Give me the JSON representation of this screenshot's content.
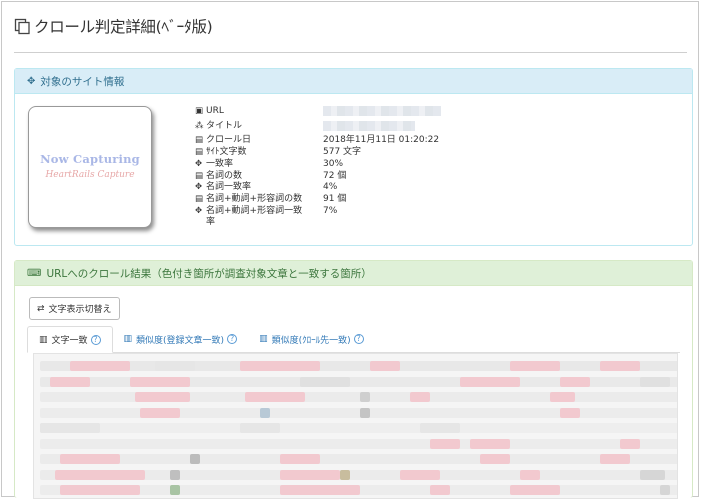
{
  "page": {
    "title": "クロール判定詳細(ﾍﾞｰﾀ版)"
  },
  "site_info": {
    "heading": "対象のサイト情報",
    "thumbnail": {
      "line1": "Now Capturing",
      "line2": "HeartRails Capture"
    },
    "rows": [
      {
        "icon": "barcode-icon",
        "glyph": "▣",
        "label": "URL",
        "value": "",
        "blurred": true
      },
      {
        "icon": "sitemap-icon",
        "glyph": "⁂",
        "label": "タイトル",
        "value": "",
        "blurred": true
      },
      {
        "icon": "file-icon",
        "glyph": "▤",
        "label": "クロール日",
        "value": "2018年11月11日 01:20:22"
      },
      {
        "icon": "file-icon",
        "glyph": "▤",
        "label": "ｻｲﾄ文字数",
        "value": "577 文字"
      },
      {
        "icon": "crosshair-icon",
        "glyph": "✥",
        "label": "一致率",
        "value": "30%"
      },
      {
        "icon": "file-icon",
        "glyph": "▤",
        "label": "名詞の数",
        "value": "72 個"
      },
      {
        "icon": "crosshair-icon",
        "glyph": "✥",
        "label": "名詞一致率",
        "value": "4%"
      },
      {
        "icon": "file-icon",
        "glyph": "▤",
        "label": "名詞+動詞+形容詞の数",
        "value": "91 個"
      },
      {
        "icon": "crosshair-icon",
        "glyph": "✥",
        "label": "名詞+動詞+形容詞一致\n率",
        "value": "7%"
      }
    ]
  },
  "crawl_result": {
    "heading": "URLへのクロール結果（色付き箇所が調査対象文章と一致する箇所）",
    "switch_label": "文字表示切替え",
    "tabs": [
      {
        "label": "文字一致",
        "active": true
      },
      {
        "label": "類似度(登録文章一致)",
        "active": false
      },
      {
        "label": "類似度(ｸﾛｰﾙ先一致)",
        "active": false
      }
    ]
  },
  "colors": {
    "info_header_bg": "#d9edf7",
    "result_header_bg": "#dff0d8",
    "link": "#337ab7",
    "match_highlight": "#f2c9cf"
  }
}
